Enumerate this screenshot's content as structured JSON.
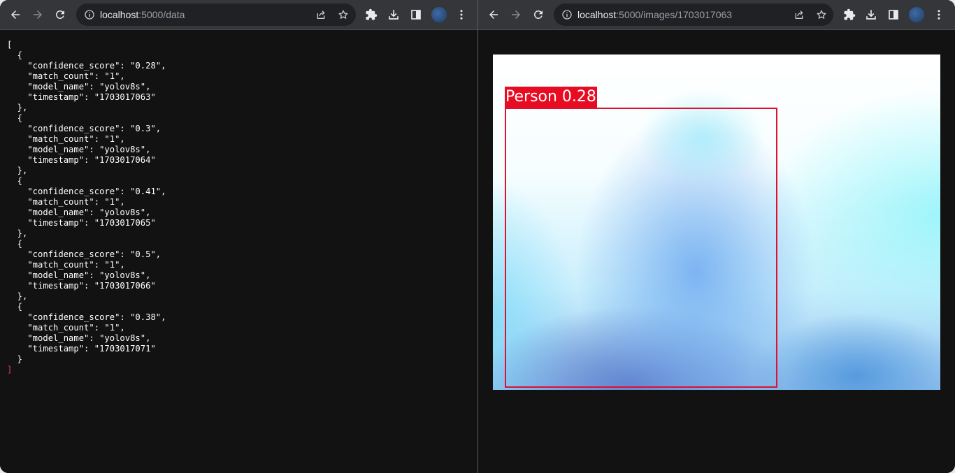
{
  "left_window": {
    "url": {
      "host": "localhost",
      "path": ":5000/data"
    },
    "json_text": "[\n  {\n    \"confidence_score\": \"0.28\",\n    \"match_count\": \"1\",\n    \"model_name\": \"yolov8s\",\n    \"timestamp\": \"1703017063\"\n  },\n  {\n    \"confidence_score\": \"0.3\",\n    \"match_count\": \"1\",\n    \"model_name\": \"yolov8s\",\n    \"timestamp\": \"1703017064\"\n  },\n  {\n    \"confidence_score\": \"0.41\",\n    \"match_count\": \"1\",\n    \"model_name\": \"yolov8s\",\n    \"timestamp\": \"1703017065\"\n  },\n  {\n    \"confidence_score\": \"0.5\",\n    \"match_count\": \"1\",\n    \"model_name\": \"yolov8s\",\n    \"timestamp\": \"1703017066\"\n  },\n  {\n    \"confidence_score\": \"0.38\",\n    \"match_count\": \"1\",\n    \"model_name\": \"yolov8s\",\n    \"timestamp\": \"1703017071\"\n  }\n",
    "json_close": "]"
  },
  "right_window": {
    "url": {
      "host": "localhost",
      "path": ":5000/images/1703017063"
    },
    "detection": {
      "label": "Person 0.28",
      "box_color": "#e0102f"
    }
  },
  "toolbar_icons": [
    "back-icon",
    "forward-icon",
    "reload-icon",
    "site-info-icon",
    "share-icon",
    "bookmark-star-icon",
    "extensions-icon",
    "download-icon",
    "side-panel-icon",
    "profile-avatar",
    "more-menu-icon"
  ],
  "colors": {
    "toolbar": "#35363a",
    "omnibox": "#202124",
    "page_background": "#121212",
    "text": "#e8eaed"
  }
}
